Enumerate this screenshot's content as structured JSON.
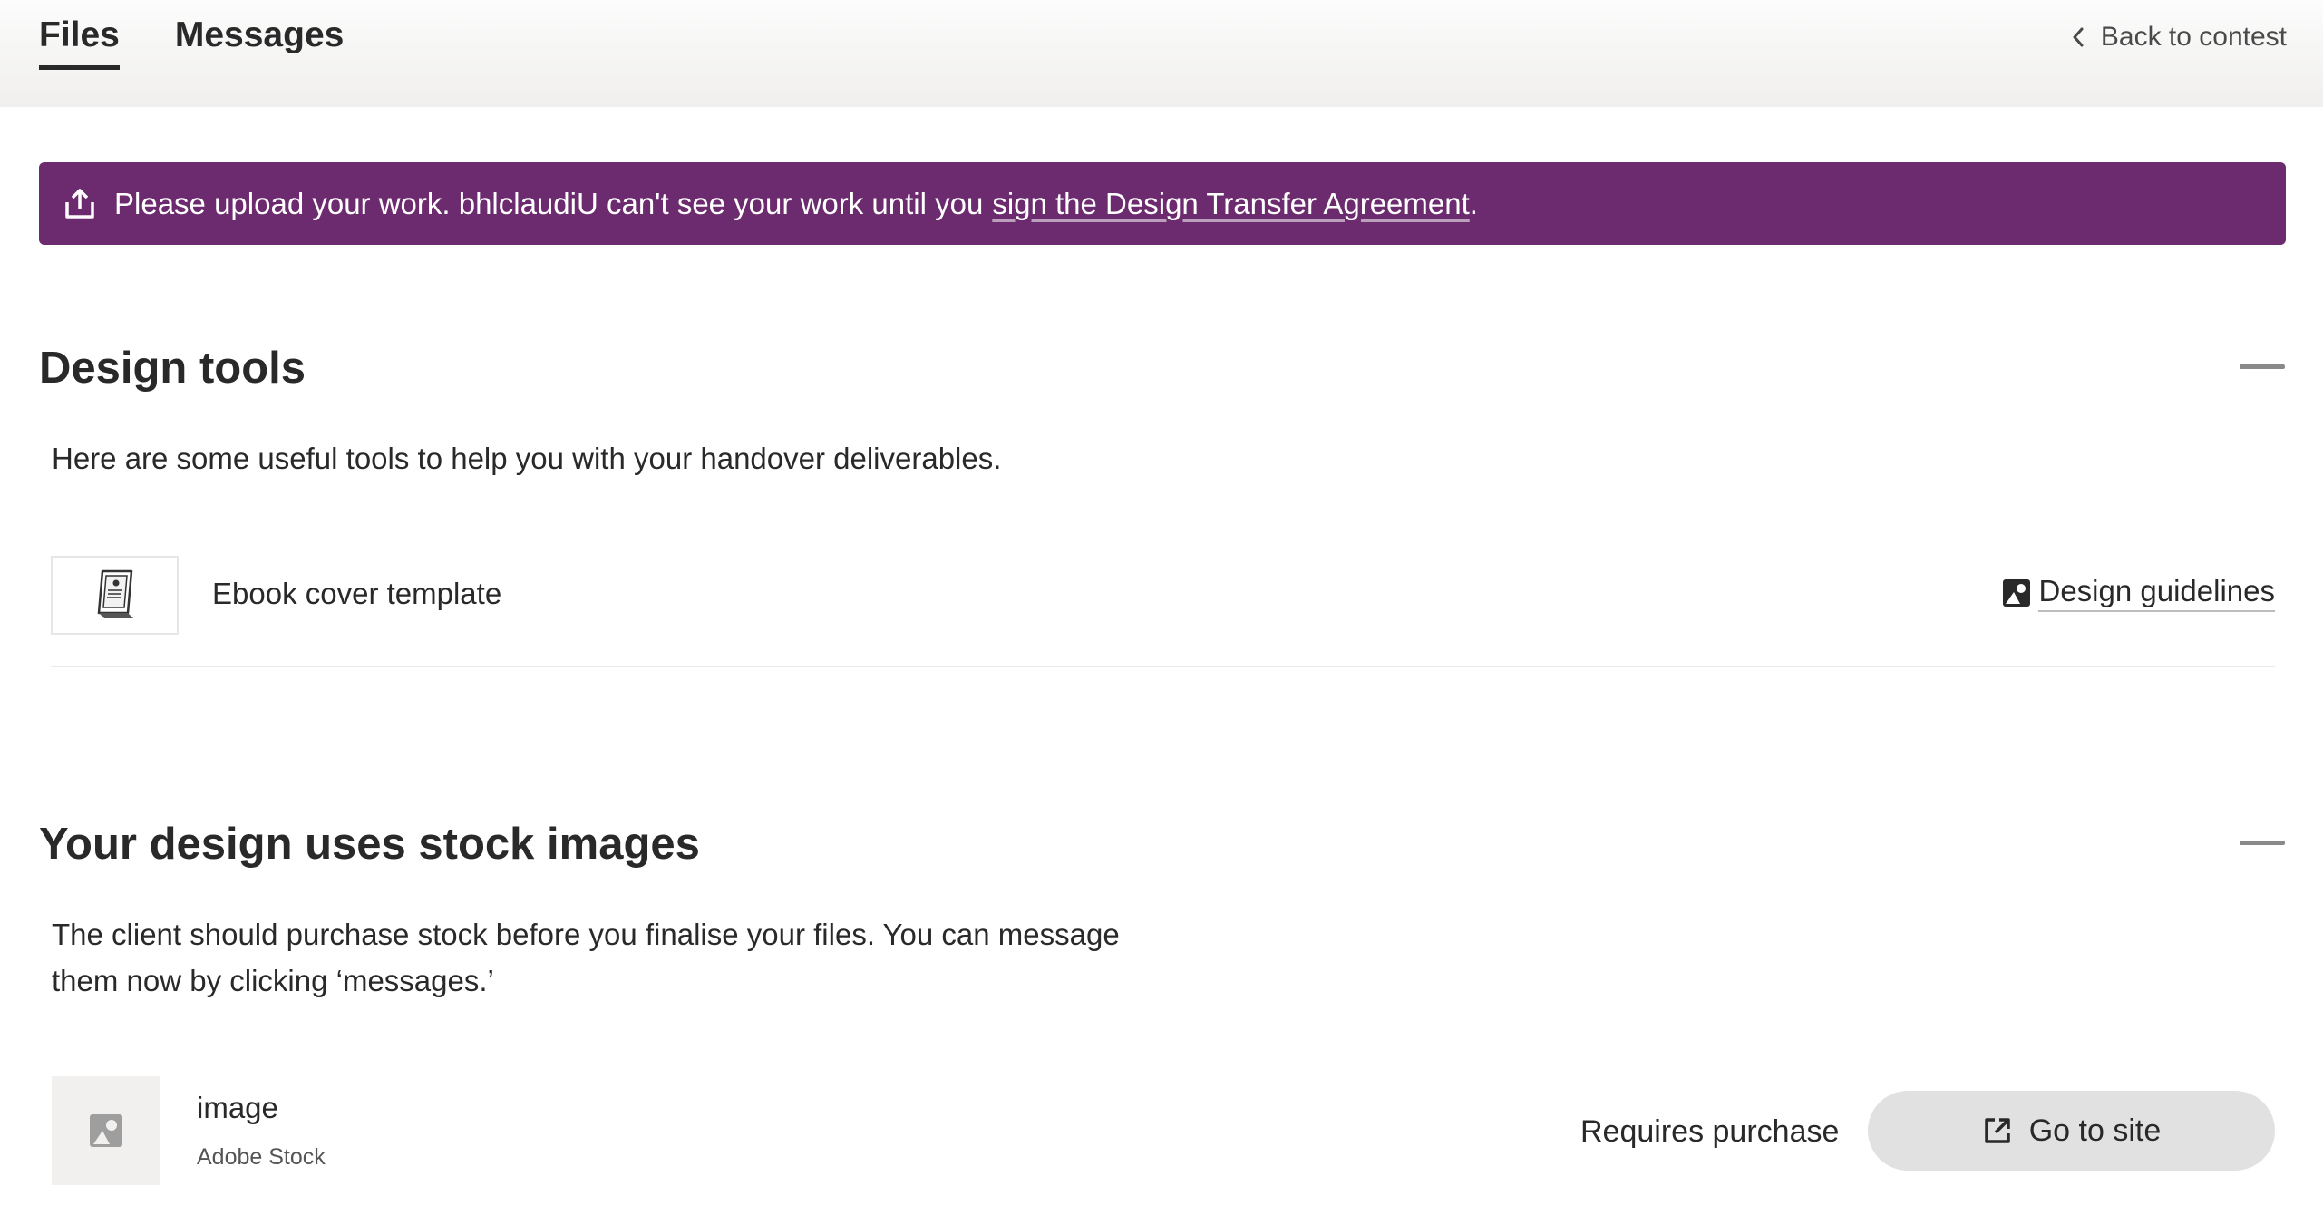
{
  "tabs": [
    {
      "label": "Files",
      "active": true
    },
    {
      "label": "Messages",
      "active": false
    }
  ],
  "back_link": {
    "label": "Back to contest",
    "icon": "chevron-left-icon"
  },
  "banner": {
    "icon": "upload-icon",
    "text": "Please upload your work. bhlclaudiU can't see your work until you",
    "link_text": "sign the Design Transfer Agreement",
    "suffix": ".",
    "background": "#6c2b6e"
  },
  "design_tools": {
    "title": "Design tools",
    "description": "Here are some useful tools to help you with your handover deliverables.",
    "items": [
      {
        "name": "Ebook cover template",
        "thumbnail_icon": "ebook-reader-icon",
        "action_label": "Design guidelines",
        "action_icon": "image-icon"
      }
    ]
  },
  "stock_images": {
    "title": "Your design uses stock images",
    "description_line1": "The client should purchase stock before you finalise your files. You can message",
    "description_line2": "them now by clicking ‘messages.’",
    "items": [
      {
        "name": "image",
        "source": "Adobe Stock",
        "status": "Requires purchase",
        "button_label": "Go to site",
        "button_icon": "external-link-icon",
        "thumbnail_icon": "image-placeholder-icon"
      }
    ]
  }
}
